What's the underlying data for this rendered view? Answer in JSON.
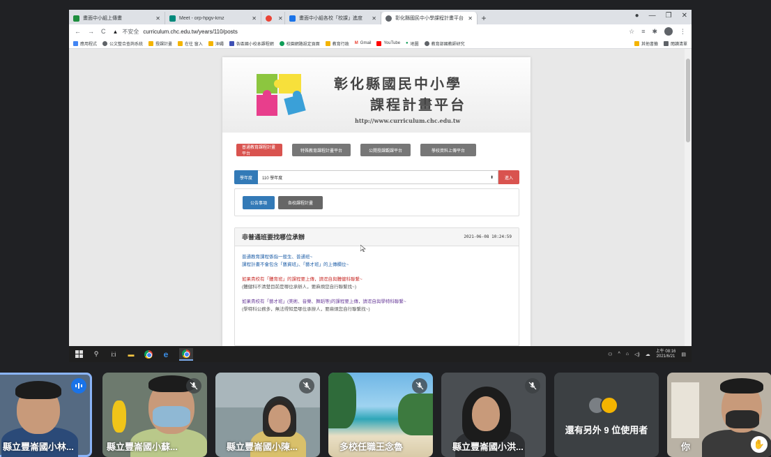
{
  "browser": {
    "tabs": [
      {
        "label": "畫面中小組上傳畫",
        "icon": "classroom-icon",
        "color": "#1e8e3e",
        "active": false
      },
      {
        "label": "Meet - orp-hpgv-kmz",
        "icon": "meet-icon",
        "color": "#00897b",
        "active": false
      },
      {
        "label": "",
        "icon": "record-icon",
        "color": "#ea4335",
        "active": false
      },
      {
        "label": "畫面中小組各校「校課」進度",
        "icon": "ext-icon",
        "color": "#1a73e8",
        "active": false
      },
      {
        "label": "彰化縣國民中小學課程計畫平台",
        "icon": "globe-icon",
        "color": "#5f6368",
        "active": true
      }
    ],
    "newtab": "+",
    "address": {
      "security": "不安全",
      "url": "curriculum.chc.edu.tw/years/110/posts"
    },
    "bookmarks": [
      "應用程式",
      "公文整合查詢系統",
      "授課計畫",
      "在往 窗入",
      "沖繩",
      "各區國小校本課程網",
      "校園網路設定頁面",
      "教育行政",
      "Gmail",
      "YouTube",
      "地圖",
      "教育部國教師研究"
    ],
    "bookmarks_right": [
      "其他書籤",
      "閱讀清單"
    ]
  },
  "site": {
    "title": "彰化縣國民中小學",
    "subtitle": "課程計畫平台",
    "url": "http://www.curriculum.chc.edu.tw",
    "nav": [
      "普通教育課程計畫平台",
      "特殊教育課程計畫平台",
      "公開授課觀課平台",
      "學校資料上傳平台"
    ],
    "year_label": "學年度",
    "year_value": "110 學年度",
    "enter": "進入",
    "subtabs": [
      "公告事項",
      "各校課程計畫"
    ]
  },
  "notice": {
    "title": "非普通班要找哪位承辦",
    "time": "2021-06-08 10:24:59",
    "lines": [
      {
        "text": "普通教育課程係指一般生、普通班~",
        "tone": "blue"
      },
      {
        "text": "課程計畫不會包含「藝資班」、「藝才班」的上傳欄位~",
        "tone": "blue"
      },
      {
        "text": "如果貴校有「體育班」的課程要上傳，請逕自與體健科聯繫~",
        "tone": "red"
      },
      {
        "text": "(體健科不清楚目前是哪位承辦人，要麻煩您自行聯繫找~)",
        "tone": "gray"
      },
      {
        "text": "如果貴校有「藝才班」(美術、音樂、舞蹈等)的課程要上傳，請逕自與學特科聯繫~",
        "tone": "purple"
      },
      {
        "text": "(學特科公務多，無法得知是哪位承辦人，要麻煩您自行聯繫找~)",
        "tone": "gray"
      }
    ]
  },
  "taskbar": {
    "search": "i:i",
    "time": "上午 08:16",
    "date": "2021/6/21"
  },
  "participants": [
    {
      "name": "縣立豐崙國小林...",
      "speaking": true
    },
    {
      "name": "縣立豐崙國小蘇...",
      "speaking": false
    },
    {
      "name": "縣立豐崙國小陳...",
      "speaking": false
    },
    {
      "name": "多校任職王念魯",
      "speaking": false
    },
    {
      "name": "縣立豐崙國小洪...",
      "speaking": false
    },
    {
      "name": "還有另外 9 位使用者",
      "speaking": false
    },
    {
      "name": "你",
      "speaking": false
    }
  ]
}
